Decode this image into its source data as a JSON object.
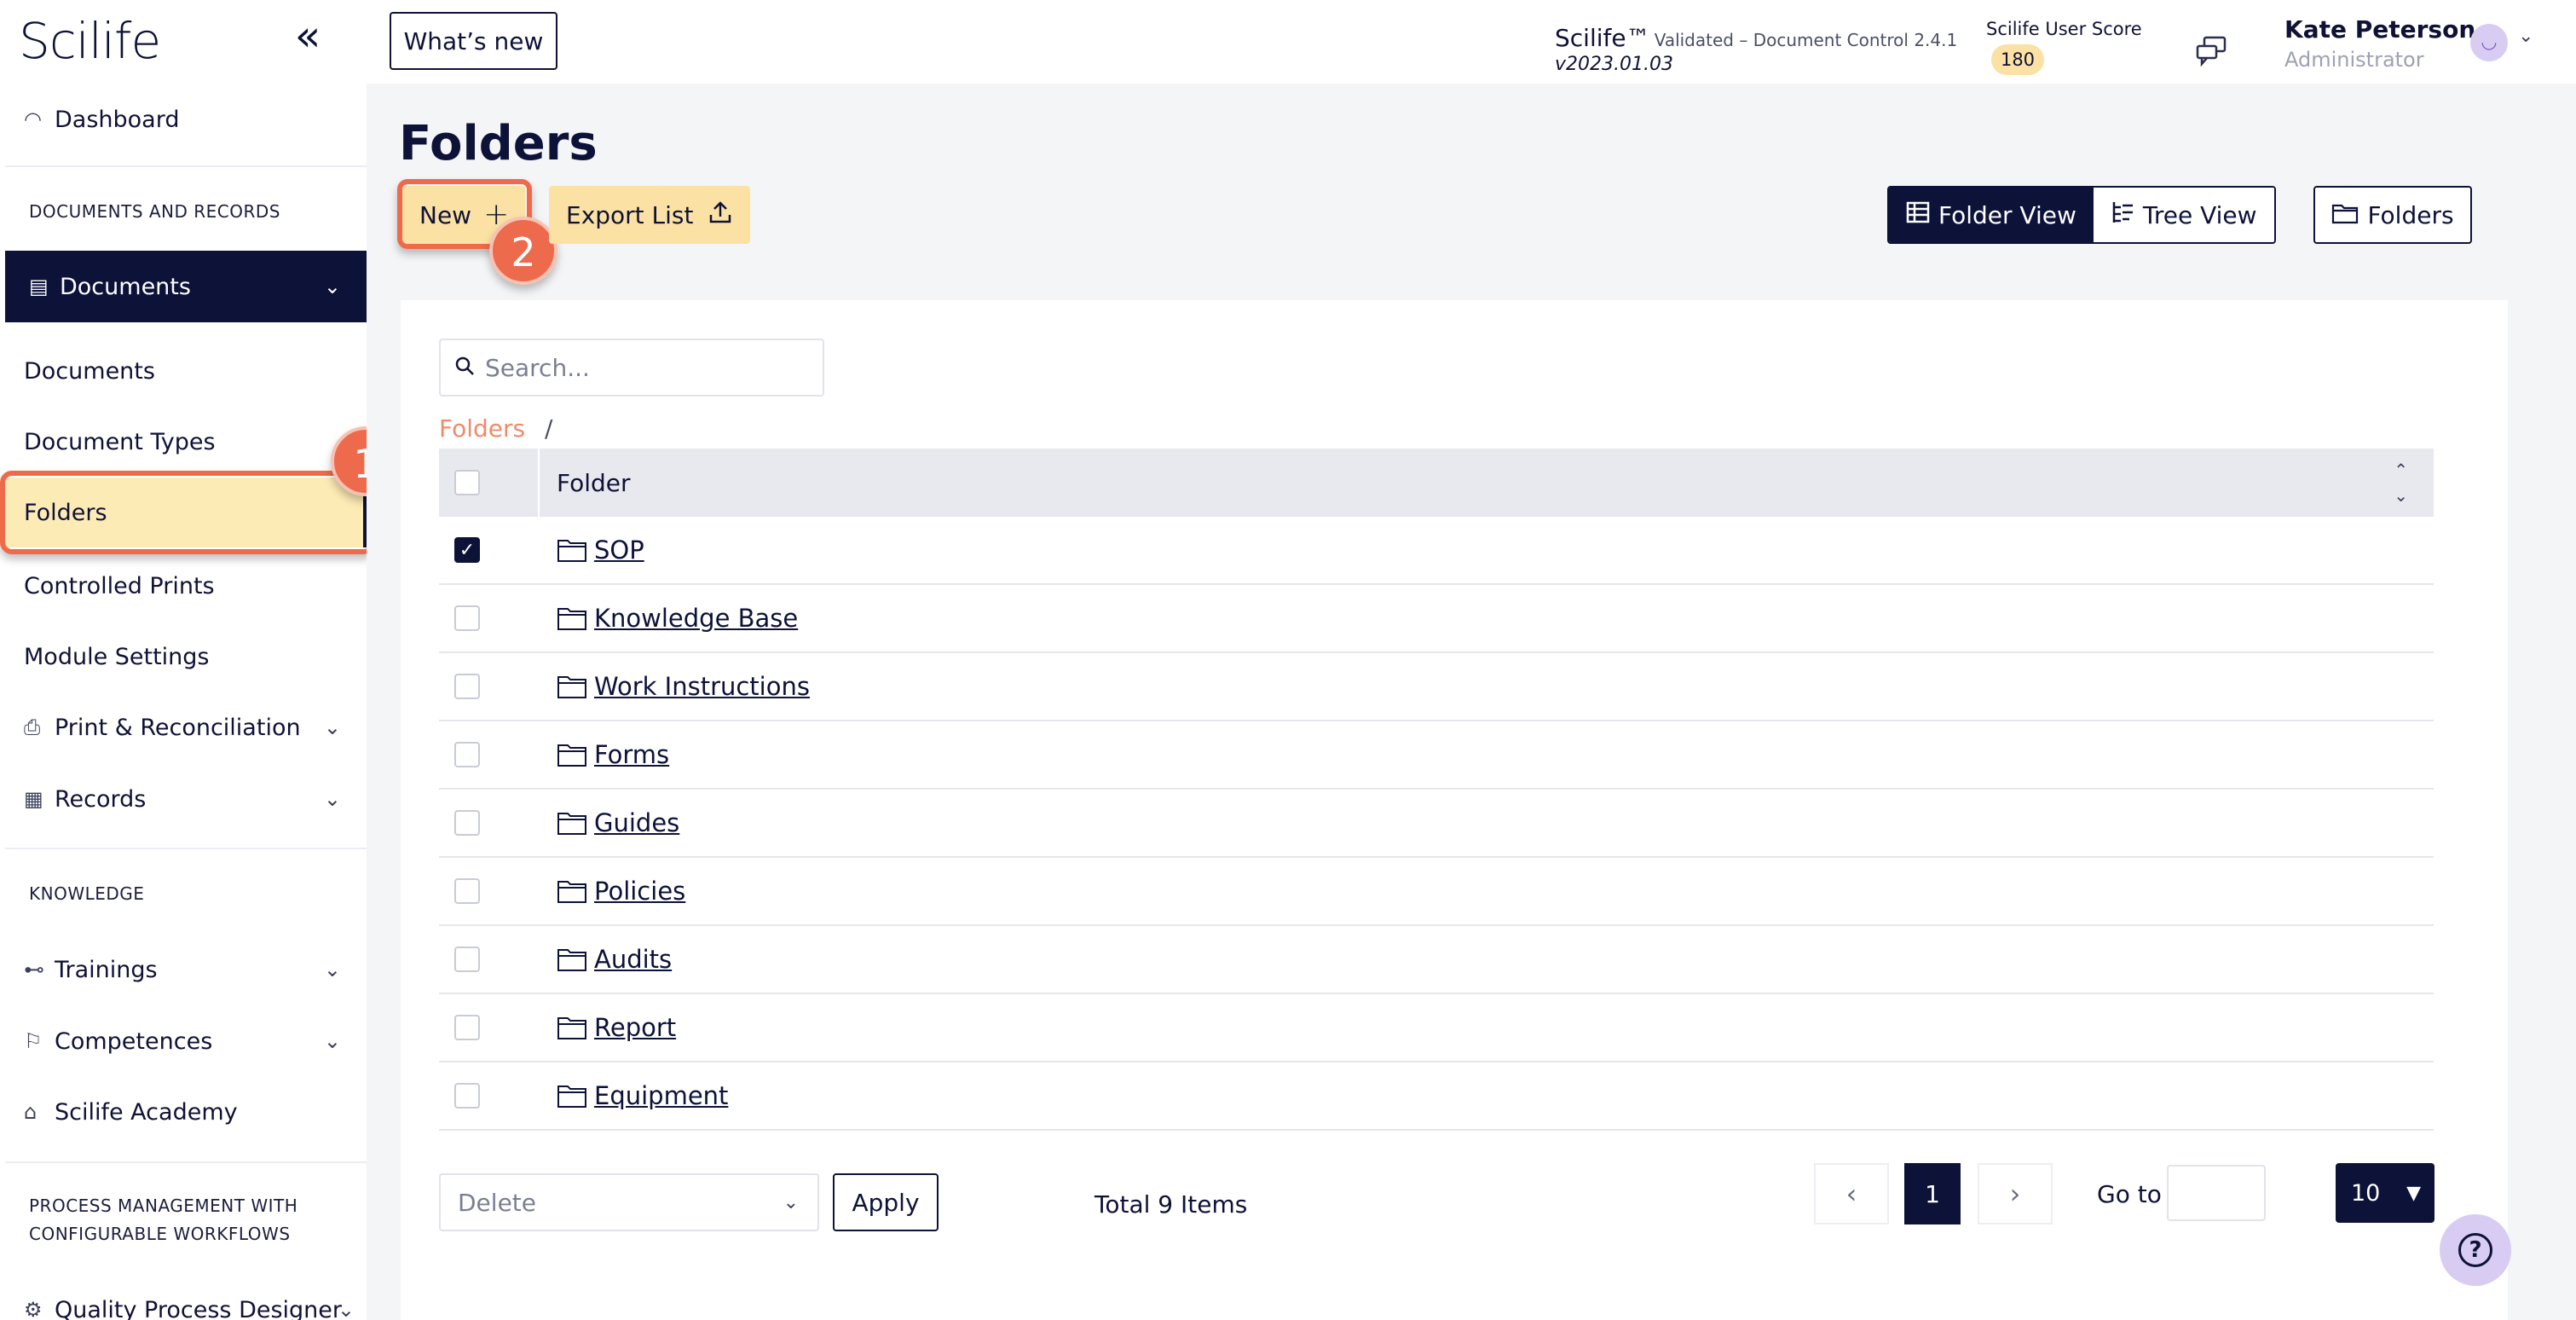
{
  "brand": {
    "logo": "Scilife",
    "collapse_glyph": "«"
  },
  "header": {
    "whats_new": "What’s new",
    "product_name": "Scilife™",
    "product_sub": "Validated – Document Control 2.4.1",
    "product_version": "v2023.01.03",
    "score_label": "Scilife User Score",
    "score_value": "180",
    "user_name": "Kate Peterson",
    "user_role": "Administrator"
  },
  "sidebar": {
    "dashboard": "Dashboard",
    "section_docs": "DOCUMENTS AND RECORDS",
    "documents_group": "Documents",
    "sub_items": [
      "Documents",
      "Document Types",
      "Folders",
      "Controlled Prints",
      "Module Settings"
    ],
    "print_reconciliation": "Print & Reconciliation",
    "records": "Records",
    "section_knowledge": "KNOWLEDGE",
    "trainings": "Trainings",
    "competences": "Competences",
    "academy": "Scilife Academy",
    "section_process_1": "PROCESS MANAGEMENT WITH",
    "section_process_2": "CONFIGURABLE WORKFLOWS",
    "quality_process_designer": "Quality Process Designer"
  },
  "annotations": {
    "step_1": "1",
    "step_2": "2"
  },
  "main": {
    "title": "Folders",
    "new_button": "New",
    "export_button": "Export List",
    "folder_view": "Folder View",
    "tree_view": "Tree View",
    "folders_button": "Folders",
    "search_placeholder": "Search...",
    "breadcrumb_root": "Folders",
    "breadcrumb_sep": "/",
    "column_folder": "Folder",
    "rows": [
      {
        "name": "SOP",
        "checked": true
      },
      {
        "name": "Knowledge Base",
        "checked": false
      },
      {
        "name": "Work Instructions",
        "checked": false
      },
      {
        "name": "Forms",
        "checked": false
      },
      {
        "name": "Guides",
        "checked": false
      },
      {
        "name": "Policies",
        "checked": false
      },
      {
        "name": "Audits",
        "checked": false
      },
      {
        "name": "Report",
        "checked": false
      },
      {
        "name": "Equipment",
        "checked": false
      }
    ],
    "bulk_action": "Delete",
    "apply": "Apply",
    "total": "Total 9 Items",
    "current_page": "1",
    "goto_label": "Go to",
    "page_size": "10"
  },
  "colors": {
    "navy": "#0d1238",
    "accent_yellow": "#fbe2a4",
    "annotation_orange": "#ee6a4c"
  }
}
